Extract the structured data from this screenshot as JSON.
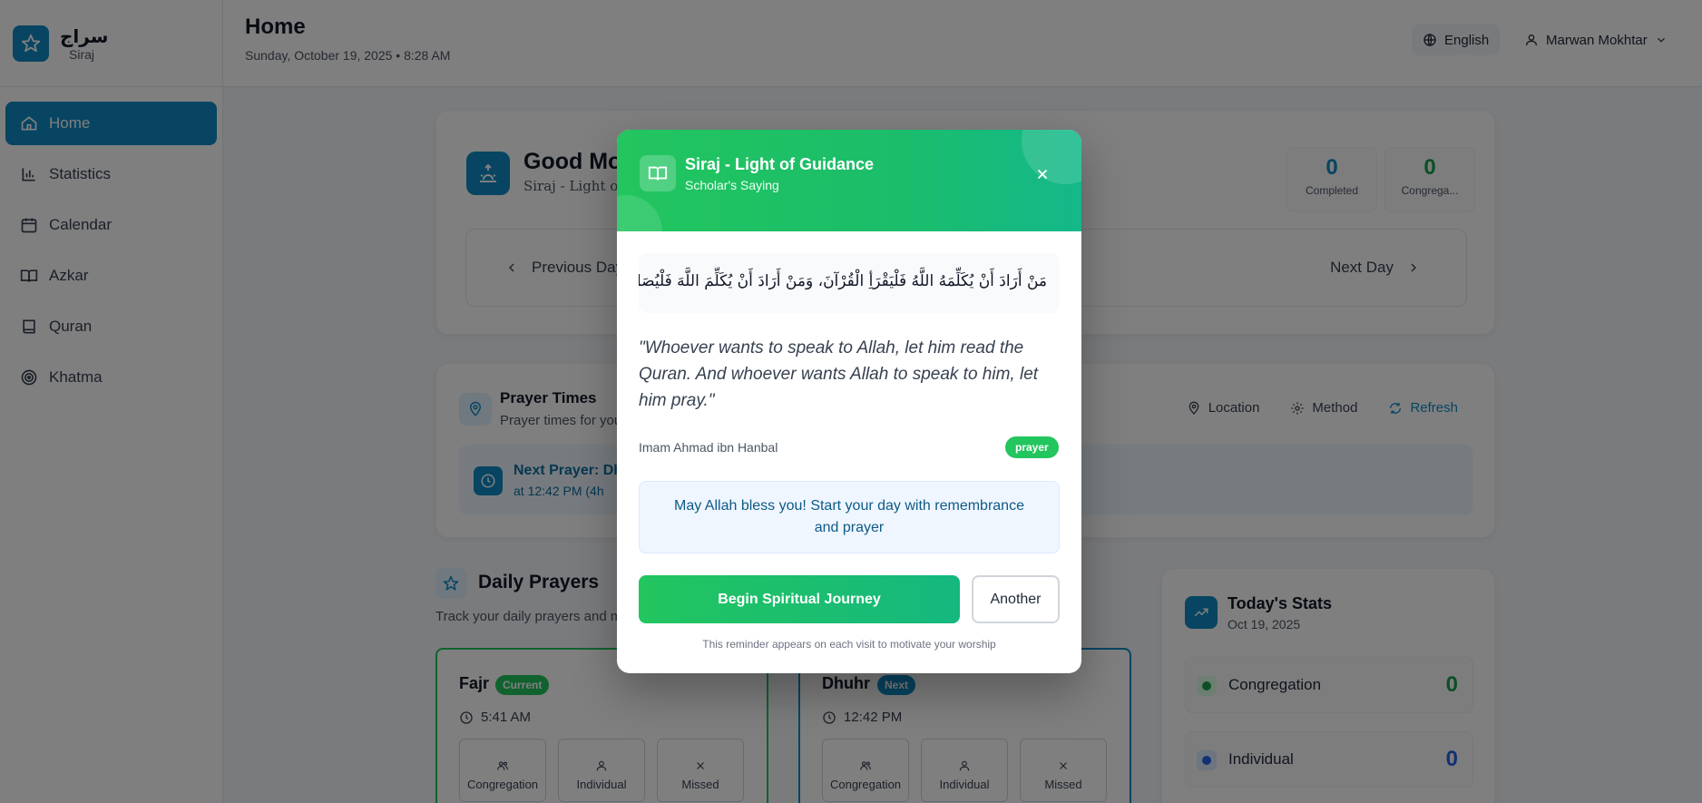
{
  "brand": {
    "arabic": "سراج",
    "name": "Siraj"
  },
  "sidebar": {
    "items": [
      {
        "label": "Home",
        "icon": "home-icon",
        "active": true
      },
      {
        "label": "Statistics",
        "icon": "bar-chart-icon"
      },
      {
        "label": "Calendar",
        "icon": "calendar-icon"
      },
      {
        "label": "Azkar",
        "icon": "open-book-icon"
      },
      {
        "label": "Quran",
        "icon": "book-icon"
      },
      {
        "label": "Khatma",
        "icon": "target-icon"
      }
    ]
  },
  "header": {
    "title": "Home",
    "date": "Sunday, October 19, 2025 • 8:28 AM",
    "language": "English",
    "user": "Marwan Mokhtar"
  },
  "greeting": {
    "title": "Good Mo",
    "subtitle": "Siraj - Light of G",
    "stats": [
      {
        "value": "0",
        "label": "Completed",
        "color": "#0e8ac4"
      },
      {
        "value": "0",
        "label": "Congrega...",
        "color": "#16a34a"
      }
    ],
    "prev_day": "Previous Day",
    "next_day": "Next Day"
  },
  "prayer_times": {
    "title": "Prayer Times",
    "subtitle": "Prayer times for you",
    "location": "Location",
    "method": "Method",
    "refresh": "Refresh",
    "next_title": "Next Prayer: Dh",
    "next_time": "at 12:42 PM  (4h"
  },
  "daily_prayers": {
    "title": "Daily Prayers",
    "subtitle": "Track your daily prayers and m",
    "options": {
      "congregation": "Congregation",
      "individual": "Individual",
      "missed": "Missed"
    },
    "cards": [
      {
        "name": "Fajr",
        "badge": "Current",
        "badge_color": "#22c55e",
        "time": "5:41 AM"
      },
      {
        "name": "Dhuhr",
        "badge": "Next",
        "badge_color": "#0e8ac4",
        "time": "12:42 PM"
      }
    ]
  },
  "todays_stats": {
    "title": "Today's Stats",
    "date": "Oct 19, 2025",
    "rows": [
      {
        "label": "Congregation",
        "value": "0",
        "color": "#16a34a",
        "bg": "#dcfce7"
      },
      {
        "label": "Individual",
        "value": "0",
        "color": "#2563eb",
        "bg": "#dbeafe"
      }
    ]
  },
  "modal": {
    "title": "Siraj - Light of Guidance",
    "subtitle": "Scholar's Saying",
    "arabic": "مَنْ أَرَادَ أَنْ يُكَلِّمَهُ اللَّهُ فَلْيَقْرَأِ الْقُرْآنَ، وَمَنْ أَرَادَ أَنْ يُكَلِّمَ اللَّهَ فَلْيُصَلِّ",
    "quote": "\"Whoever wants to speak to Allah, let him read the Quran. And whoever wants Allah to speak to him, let him pray.\"",
    "author": "Imam Ahmad ibn Hanbal",
    "tag": "prayer",
    "blessing": "May Allah bless you! Start your day with remembrance and prayer",
    "begin_label": "Begin Spiritual Journey",
    "another_label": "Another",
    "footer": "This reminder appears on each visit to motivate your worship"
  }
}
